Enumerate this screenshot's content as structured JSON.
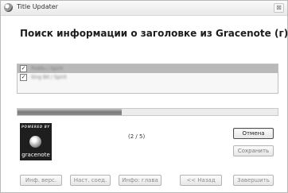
{
  "window": {
    "title": "Title Updater",
    "close_symbol": "⊠"
  },
  "heading": "Поиск информации о заголовке из Gracenote (г).",
  "list": {
    "items": [
      {
        "checked": true,
        "check_symbol": "✓",
        "text": "Poddu / Spirit",
        "selected": true
      },
      {
        "checked": true,
        "check_symbol": "✓",
        "text": "Sing Bit / Spirit",
        "selected": false
      }
    ]
  },
  "progress": {
    "fraction": 0.4
  },
  "logo": {
    "top_text": "POWERED BY",
    "word": "gracenote"
  },
  "counter": "(2 / 5)",
  "buttons": {
    "cancel": "Отмена",
    "save": "Сохранить",
    "info_version": "Инф. верс.",
    "connection_settings": "Наст. соед.",
    "chapter_info": "Инфо: глава",
    "back": "<< Назад",
    "finish": "Завершить"
  }
}
